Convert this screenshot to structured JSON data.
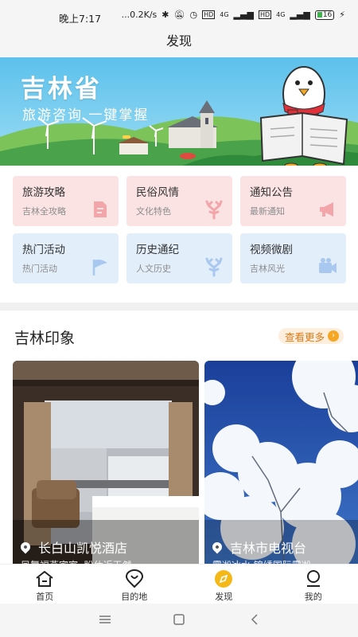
{
  "status_bar": {
    "time": "晚上7:17",
    "network_speed": "...0.2K/s",
    "signal_1": "4G",
    "signal_2": "4G",
    "hd_1": "HD",
    "hd_2": "HD",
    "battery": "16"
  },
  "header": {
    "title": "发现"
  },
  "banner": {
    "title": "吉林省",
    "subtitle": "旅游咨询 一键掌握"
  },
  "categories": [
    {
      "title": "旅游攻略",
      "subtitle": "吉林全攻略",
      "icon": "document-icon",
      "theme": "pink"
    },
    {
      "title": "民俗风情",
      "subtitle": "文化特色",
      "icon": "antler-icon",
      "theme": "pink"
    },
    {
      "title": "通知公告",
      "subtitle": "最新通知",
      "icon": "megaphone-icon",
      "theme": "pink"
    },
    {
      "title": "热门活动",
      "subtitle": "热门活动",
      "icon": "flag-icon",
      "theme": "blue"
    },
    {
      "title": "历史通纪",
      "subtitle": "人文历史",
      "icon": "antler-icon",
      "theme": "blue"
    },
    {
      "title": "视频微剧",
      "subtitle": "吉林风光",
      "icon": "video-camera-icon",
      "theme": "blue"
    }
  ],
  "impressions": {
    "title": "吉林印象",
    "more_label": "查看更多",
    "items": [
      {
        "name": "长白山凯悦酒店",
        "desc": "凤舞福燕宾室, 盼休近天然"
      },
      {
        "name": "吉林市电视台",
        "desc": "雾凇冰水·锦绣国际雾凇"
      }
    ]
  },
  "tabbar": {
    "items": [
      {
        "label": "首页",
        "icon": "home-icon"
      },
      {
        "label": "目的地",
        "icon": "location-icon"
      },
      {
        "label": "发现",
        "icon": "compass-icon",
        "active": true
      },
      {
        "label": "我的",
        "icon": "profile-icon"
      }
    ]
  },
  "colors": {
    "pink_card": "#fbe3e4",
    "blue_card": "#e3eefb",
    "pink_icon": "#f2a6aa",
    "blue_icon": "#a9c8ef",
    "accent": "#f5a623",
    "more_text": "#e07a17"
  }
}
